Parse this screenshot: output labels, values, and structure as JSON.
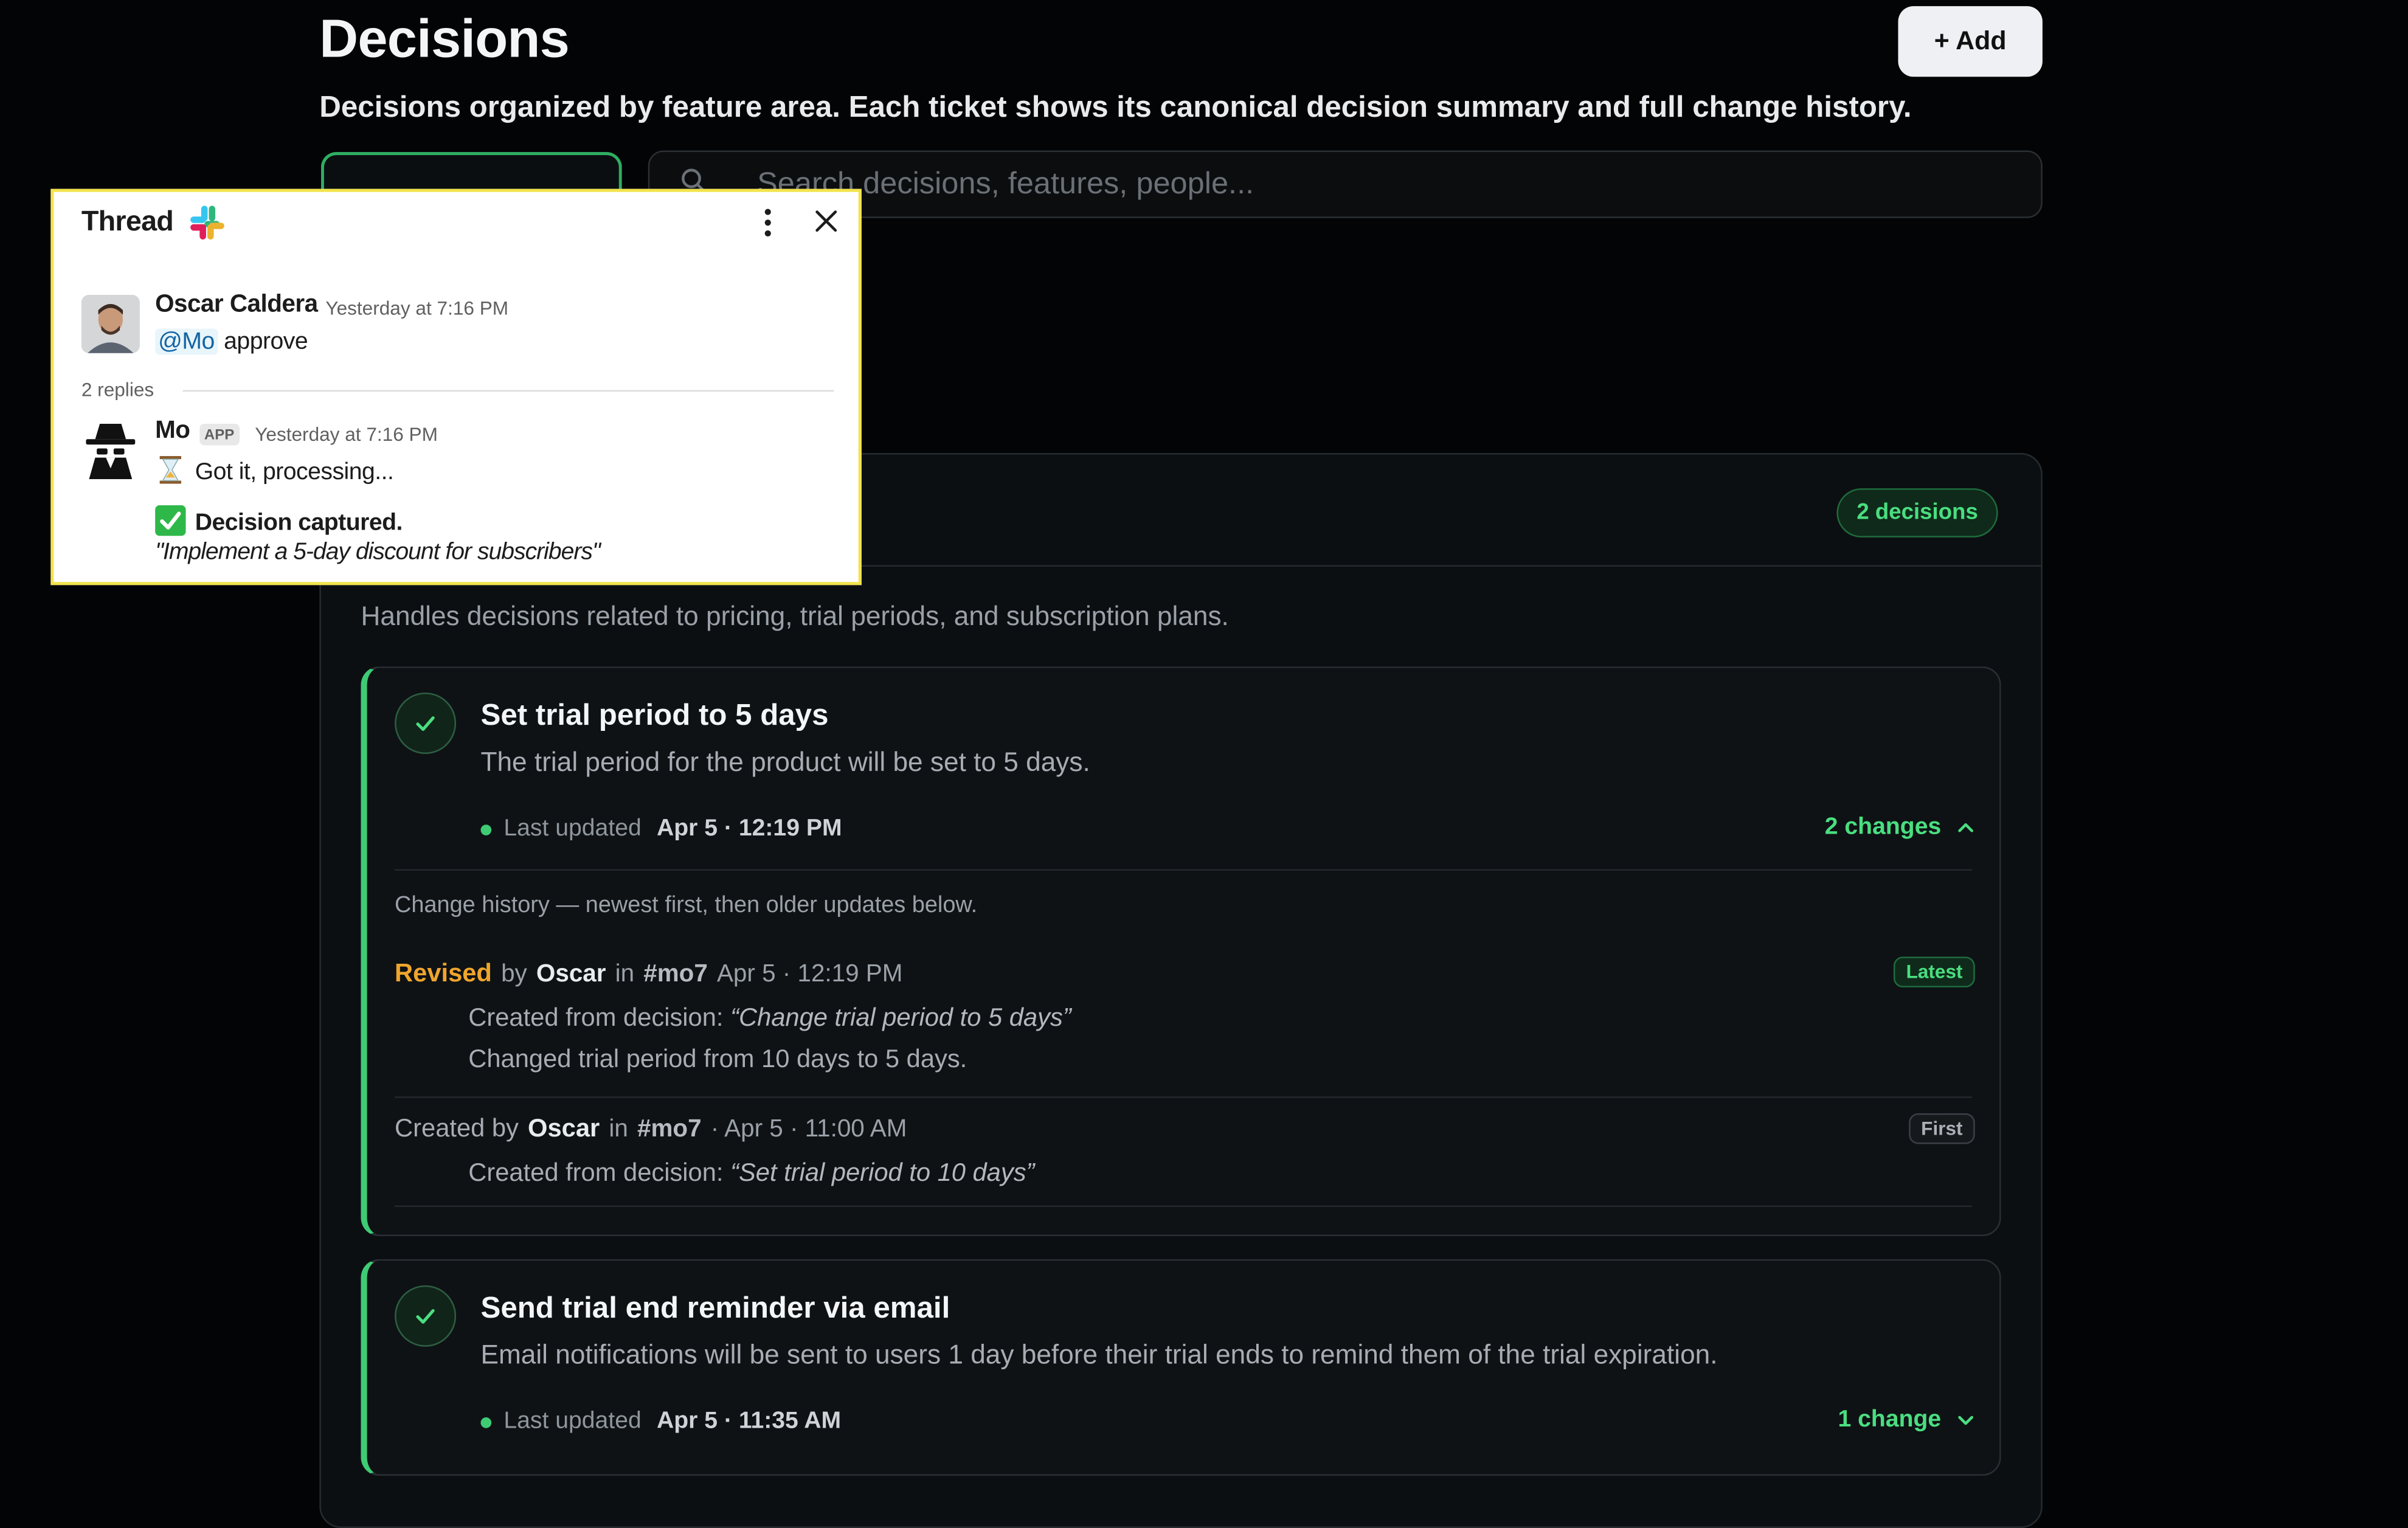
{
  "page": {
    "title": "Decisions",
    "subtitle": "Decisions organized by feature area. Each ticket shows its canonical decision summary and full change history.",
    "add_label": "+ Add"
  },
  "search": {
    "placeholder": "Search decisions, features, people..."
  },
  "feature_area": {
    "badge": "2 decisions",
    "description": "Handles decisions related to pricing, trial periods, and subscription plans.",
    "decisions": [
      {
        "title": "Set trial period to 5 days",
        "description": "The trial period for the product will be set to 5 days.",
        "meta_label": "Last updated",
        "meta_time": "Apr 5 · 12:19 PM",
        "changes_label": "2 changes",
        "history_note": "Change history — newest first, then older updates below.",
        "history": [
          {
            "status": "Revised",
            "by": "by",
            "author": "Oscar",
            "in": "in",
            "channel": "#mo7",
            "time": "Apr 5 · 12:19 PM",
            "tag": "Latest",
            "source_prefix": "Created from decision:",
            "source": "“Change trial period to 5 days”",
            "detail": "Changed trial period from 10 days to 5 days."
          },
          {
            "status": "Created by",
            "author": "Oscar",
            "in": "in",
            "channel": "#mo7",
            "time": "· Apr 5 · 11:00 AM",
            "tag": "First",
            "source_prefix": "Created from decision:",
            "source": "“Set trial period to 10 days”"
          }
        ]
      },
      {
        "title": "Send trial end reminder via email",
        "description": "Email notifications will be sent to users 1 day before their trial ends to remind them of the trial expiration.",
        "meta_label": "Last updated",
        "meta_time": "Apr 5 · 11:35 AM",
        "changes_label": "1 change"
      }
    ]
  },
  "thread": {
    "title": "Thread",
    "messages": [
      {
        "name": "Oscar Caldera",
        "time": "Yesterday at 7:16 PM",
        "mention": "@Mo",
        "text": "approve"
      },
      {
        "name": "Mo",
        "badge": "APP",
        "time": "Yesterday at 7:16 PM",
        "text": "Got it, processing...",
        "captured": "Decision captured.",
        "quote": "\"Implement a 5-day discount for subscribers\""
      }
    ],
    "replies": "2 replies"
  },
  "colors": {
    "accent": "#4ade80",
    "revised": "#f0a52c",
    "background": "#030405",
    "popup_border": "#f2e34b"
  },
  "icons": [
    "search-icon",
    "check-icon",
    "chevron-up-icon",
    "chevron-down-icon",
    "slack-icon",
    "more-vertical-icon",
    "close-icon",
    "hourglass-icon",
    "check-mark-emoji-icon"
  ]
}
